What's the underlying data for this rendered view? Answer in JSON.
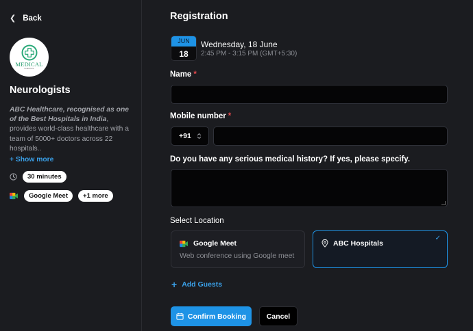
{
  "sidebar": {
    "back_label": "Back",
    "logo": {
      "word": "MEDICAL",
      "sub": "healthcare"
    },
    "title": "Neurologists",
    "desc_bold": "ABC Healthcare, recognised as one of the Best Hospitals in India",
    "desc_rest": ", provides world-class healthcare with a team of 5000+ doctors across 22 hospitals..",
    "show_more": "+ Show more",
    "duration": "30 minutes",
    "location_pill": "Google Meet",
    "more_pill": "+1 more"
  },
  "main": {
    "title": "Registration",
    "date": {
      "month": "JUN",
      "day": "18",
      "full": "Wednesday, 18 June",
      "time": "2:45 PM - 3:15 PM (GMT+5:30)"
    },
    "fields": {
      "name_label": "Name",
      "mobile_label": "Mobile number",
      "country_code": "+91",
      "history_label": "Do you have any serious medical history? If yes, please specify.",
      "required_mark": "*"
    },
    "location": {
      "label": "Select Location",
      "options": [
        {
          "name": "Google Meet",
          "desc": "Web conference using Google meet",
          "selected": false
        },
        {
          "name": "ABC Hospitals",
          "desc": "",
          "selected": true
        }
      ]
    },
    "add_guests": "Add Guests",
    "confirm_label": "Confirm Booking",
    "cancel_label": "Cancel"
  },
  "colors": {
    "accent": "#1e93e6",
    "background": "#1b1c20",
    "input_bg": "#050506",
    "required": "#e5484d"
  }
}
